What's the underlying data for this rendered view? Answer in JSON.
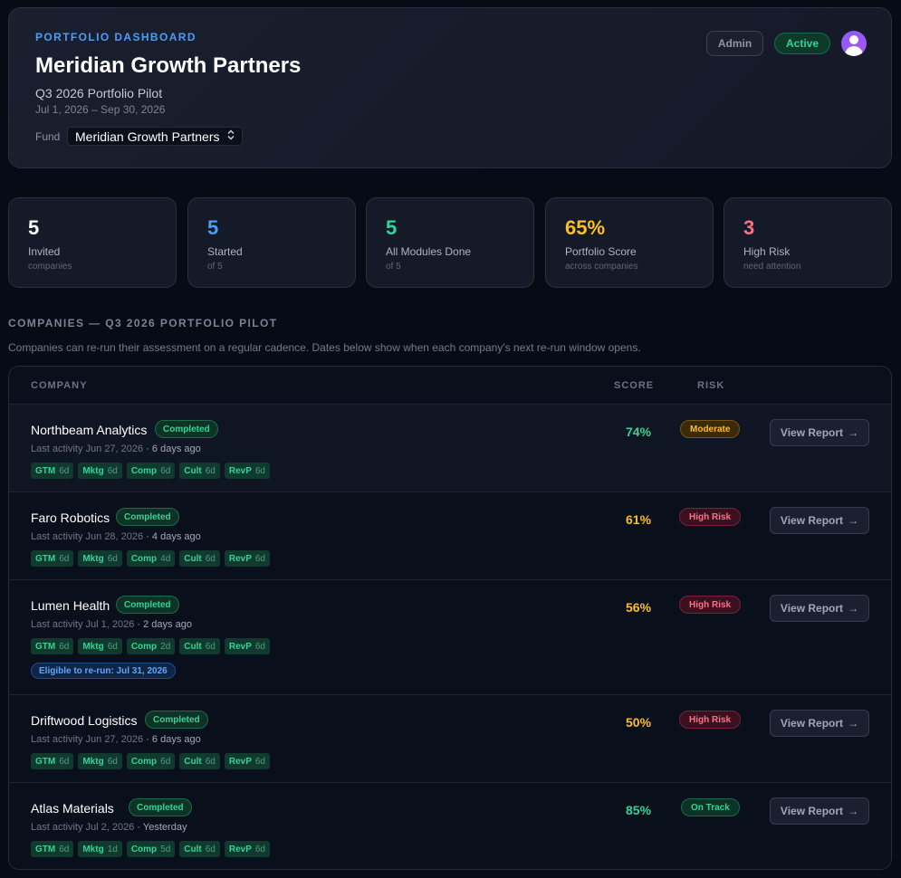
{
  "header": {
    "eyebrow": "PORTFOLIO DASHBOARD",
    "title": "Meridian Growth Partners",
    "subtitle": "Q3 2026 Portfolio Pilot",
    "date_range": "Jul 1, 2026 – Sep 30, 2026",
    "fund_label": "Fund",
    "fund_selected": "Meridian Growth Partners",
    "role_badge": "Admin",
    "status_badge": "Active"
  },
  "stats": [
    {
      "value": "5",
      "label": "Invited",
      "sub": "companies",
      "color": "#ffffff"
    },
    {
      "value": "5",
      "label": "Started",
      "sub": "of 5",
      "color": "#4d9cf6"
    },
    {
      "value": "5",
      "label": "All Modules Done",
      "sub": "of 5",
      "color": "#34d399"
    },
    {
      "value": "65%",
      "label": "Portfolio Score",
      "sub": "across companies",
      "color": "#fbbf24"
    },
    {
      "value": "3",
      "label": "High Risk",
      "sub": "need attention",
      "color": "#fb7185"
    }
  ],
  "section": {
    "title": "COMPANIES — Q3 2026 PORTFOLIO PILOT",
    "description": "Companies can re-run their assessment on a regular cadence. Dates below show when each company's next re-run window opens."
  },
  "table": {
    "headers": {
      "company": "COMPANY",
      "score": "SCORE",
      "risk": "RISK"
    },
    "view_report_label": "View Report",
    "arrow": "→",
    "rows": [
      {
        "name": "Northbeam Analytics",
        "status": "Completed",
        "activity": "Last activity Jun 27, 2026",
        "ago": "· 6 days ago",
        "modules": [
          {
            "k": "GTM",
            "d": "6d"
          },
          {
            "k": "Mktg",
            "d": "6d"
          },
          {
            "k": "Comp",
            "d": "6d"
          },
          {
            "k": "Cult",
            "d": "6d"
          },
          {
            "k": "RevP",
            "d": "6d"
          }
        ],
        "rerun": "",
        "score": "74%",
        "score_color": "#34d399",
        "risk": "Moderate",
        "risk_class": "moderate"
      },
      {
        "name": "Faro Robotics",
        "status": "Completed",
        "activity": "Last activity Jun 28, 2026",
        "ago": "· 4 days ago",
        "modules": [
          {
            "k": "GTM",
            "d": "6d"
          },
          {
            "k": "Mktg",
            "d": "6d"
          },
          {
            "k": "Comp",
            "d": "4d"
          },
          {
            "k": "Cult",
            "d": "6d"
          },
          {
            "k": "RevP",
            "d": "6d"
          }
        ],
        "rerun": "",
        "score": "61%",
        "score_color": "#fbbf24",
        "risk": "High Risk",
        "risk_class": "high"
      },
      {
        "name": "Lumen Health",
        "status": "Completed",
        "activity": "Last activity Jul 1, 2026",
        "ago": "· 2 days ago",
        "modules": [
          {
            "k": "GTM",
            "d": "6d"
          },
          {
            "k": "Mktg",
            "d": "6d"
          },
          {
            "k": "Comp",
            "d": "2d"
          },
          {
            "k": "Cult",
            "d": "6d"
          },
          {
            "k": "RevP",
            "d": "6d"
          }
        ],
        "rerun": "Eligible to re-run: Jul 31, 2026",
        "score": "56%",
        "score_color": "#fbbf24",
        "risk": "High Risk",
        "risk_class": "high"
      },
      {
        "name": "Driftwood Logistics",
        "status": "Completed",
        "activity": "Last activity Jun 27, 2026",
        "ago": "· 6 days ago",
        "modules": [
          {
            "k": "GTM",
            "d": "6d"
          },
          {
            "k": "Mktg",
            "d": "6d"
          },
          {
            "k": "Comp",
            "d": "6d"
          },
          {
            "k": "Cult",
            "d": "6d"
          },
          {
            "k": "RevP",
            "d": "6d"
          }
        ],
        "rerun": "",
        "score": "50%",
        "score_color": "#fbbf24",
        "risk": "High Risk",
        "risk_class": "high"
      },
      {
        "name": "Atlas Materials",
        "status": "Completed",
        "activity": "Last activity Jul 2, 2026",
        "ago": "· Yesterday",
        "modules": [
          {
            "k": "GTM",
            "d": "6d"
          },
          {
            "k": "Mktg",
            "d": "1d"
          },
          {
            "k": "Comp",
            "d": "5d"
          },
          {
            "k": "Cult",
            "d": "6d"
          },
          {
            "k": "RevP",
            "d": "6d"
          }
        ],
        "rerun": "",
        "score": "85%",
        "score_color": "#34d399",
        "risk": "On Track",
        "risk_class": "ontrack"
      }
    ]
  }
}
